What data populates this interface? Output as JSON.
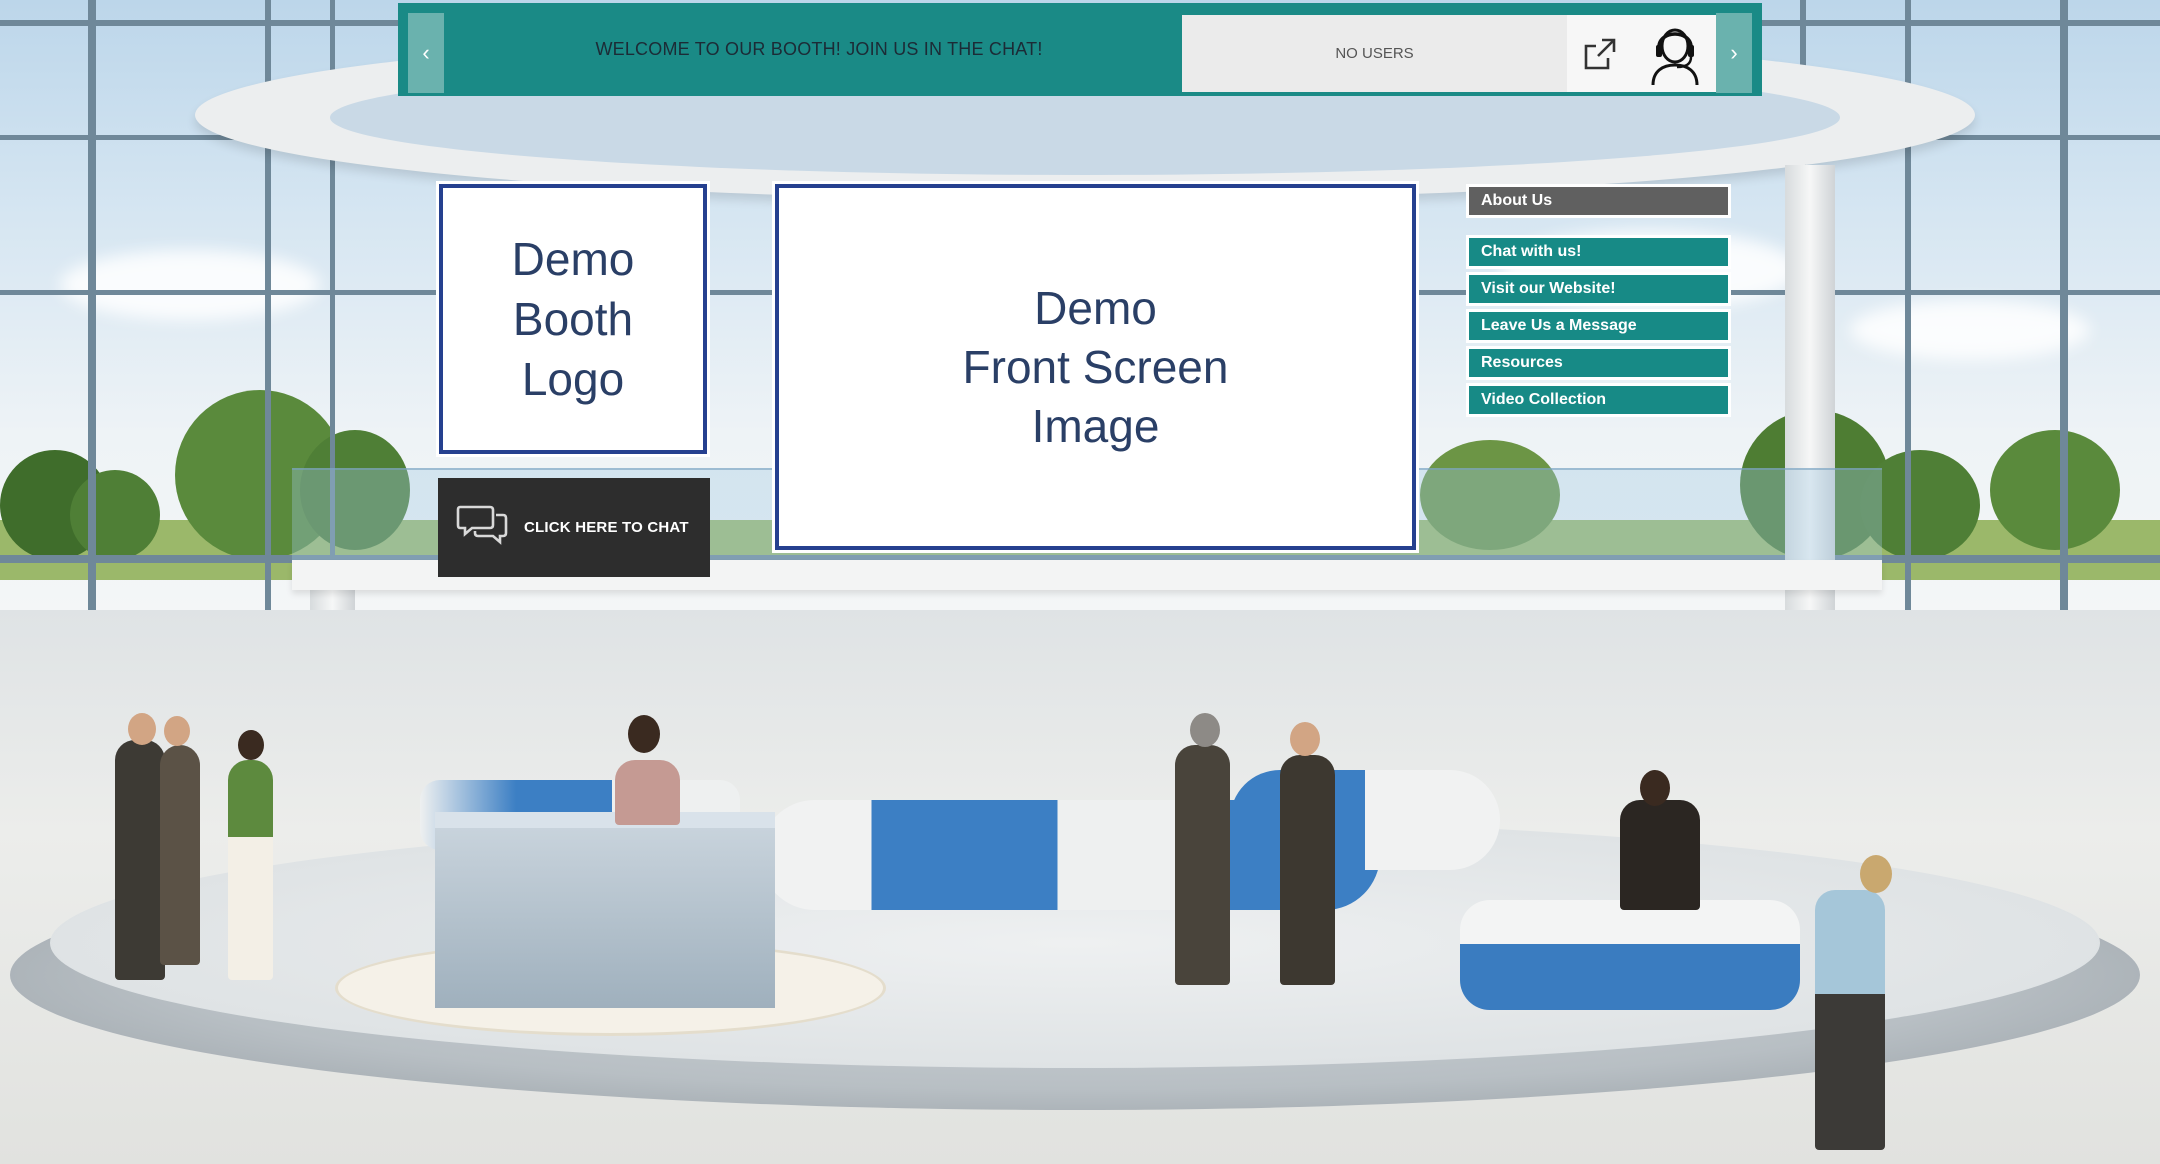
{
  "banner": {
    "welcome_text": "WELCOME TO OUR BOOTH! JOIN US IN THE CHAT!",
    "users_text": "NO USERS",
    "prev_arrow": "‹",
    "next_arrow": "›",
    "accent_color": "#1a8a86"
  },
  "logo_panel": {
    "lines": [
      "Demo",
      "Booth",
      "Logo"
    ]
  },
  "chat_button": {
    "label": "CLICK HERE TO CHAT"
  },
  "front_screen": {
    "lines": [
      "Demo",
      "Front Screen",
      "Image"
    ]
  },
  "side_menu": {
    "header": "About Us",
    "items": [
      {
        "label": "Chat with us!"
      },
      {
        "label": "Visit our Website!"
      },
      {
        "label": "Leave Us a Message"
      },
      {
        "label": "Resources"
      },
      {
        "label": "Video Collection"
      }
    ]
  },
  "icons": {
    "external_link": "external-link-icon",
    "support_agent": "support-agent-icon",
    "chat": "chat-bubbles-icon"
  }
}
